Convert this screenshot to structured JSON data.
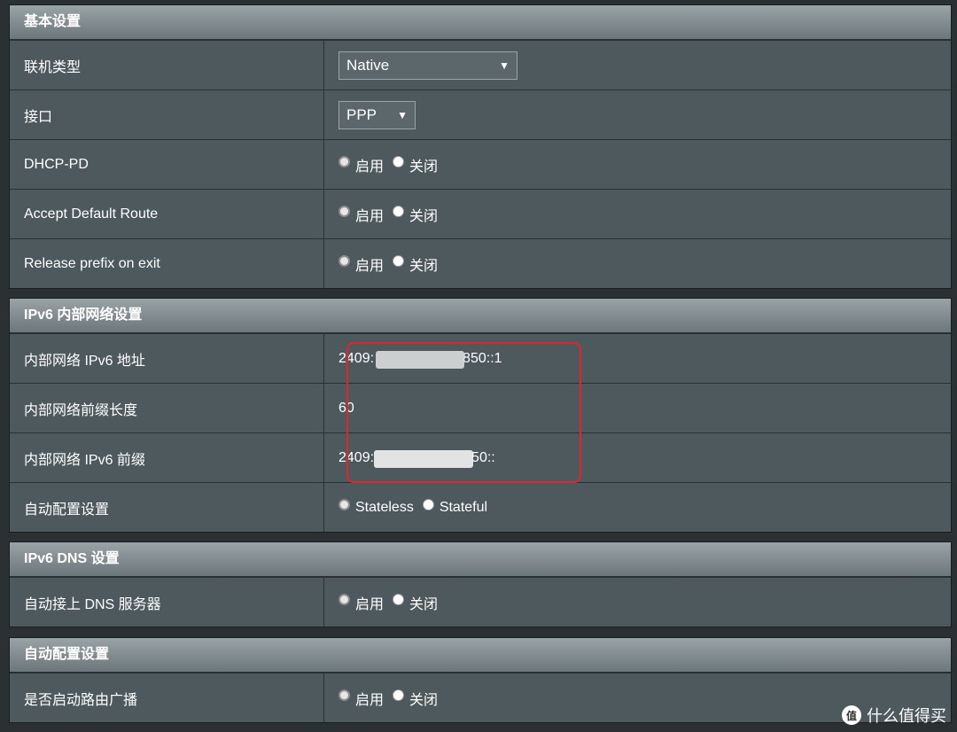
{
  "basic": {
    "title": "基本设置",
    "conn_type_label": "联机类型",
    "conn_type_value": "Native",
    "interface_label": "接口",
    "interface_value": "PPP",
    "dhcp_pd_label": "DHCP-PD",
    "accept_route_label": "Accept Default Route",
    "release_prefix_label": "Release prefix on exit",
    "enable": "启用",
    "disable": "关闭"
  },
  "lan": {
    "title": "IPv6 内部网络设置",
    "addr_label": "内部网络 IPv6 地址",
    "addr_prefix": "2409:",
    "addr_suffix": "850::1",
    "prefix_len_label": "内部网络前缀长度",
    "prefix_len_value": "60",
    "prefix_label": "内部网络 IPv6 前缀",
    "prefix_prefix": "2409:",
    "prefix_suffix": "50::",
    "autoconf_label": "自动配置设置",
    "stateless": "Stateless",
    "stateful": "Stateful"
  },
  "dns": {
    "title": "IPv6 DNS 设置",
    "auto_dns_label": "自动接上 DNS 服务器",
    "enable": "启用",
    "disable": "关闭"
  },
  "autoconf": {
    "title": "自动配置设置",
    "router_adv_label": "是否启动路由广播",
    "enable": "启用",
    "disable": "关闭"
  },
  "watermark": {
    "icon": "值",
    "text": "什么值得买"
  }
}
